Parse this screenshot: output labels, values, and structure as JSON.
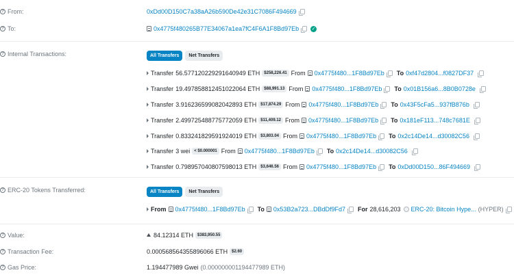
{
  "from": {
    "label": "From:",
    "address": "0xDd00D150C7a38aA26b590De42e31C7086F494669"
  },
  "to": {
    "label": "To:",
    "address": "0x4775f480265B77E34067a1ea7fC4F6A1F8Bd97Eb"
  },
  "internal": {
    "label": "Internal Transactions:",
    "tabs": [
      "All Transfers",
      "Net Transfers"
    ],
    "rows": [
      {
        "prefix": "Transfer",
        "amount": "56.577120229291640949 ETH",
        "usd": "$258,226.41",
        "from_label": "From",
        "from": "0x4775f480...1F8Bd97Eb",
        "to_label": "To",
        "to": "0xf47d2804...f0827DF37"
      },
      {
        "prefix": "Transfer",
        "amount": "19.497858812451022064 ETH",
        "usd": "$88,991.13",
        "from_label": "From",
        "from": "0x4775f480...1F8Bd97Eb",
        "to_label": "To",
        "to": "0x01B156a6...8B0B0728e"
      },
      {
        "prefix": "Transfer",
        "amount": "3.916236599082042893 ETH",
        "usd": "$17,874.29",
        "from_label": "From",
        "from": "0x4775f480...1F8Bd97Eb",
        "to_label": "To",
        "to": "0x43F5cFa5...937fB876b"
      },
      {
        "prefix": "Transfer",
        "amount": "2.499725488775772059 ETH",
        "usd": "$11,409.12",
        "from_label": "From",
        "from": "0x4775f480...1F8Bd97Eb",
        "to_label": "To",
        "to": "0x181eF113...748c7681E"
      },
      {
        "prefix": "Transfer",
        "amount": "0.833241829591924019 ETH",
        "usd": "$3,803.04",
        "from_label": "From",
        "from": "0x4775f480...1F8Bd97Eb",
        "to_label": "To",
        "to": "0x2c14De14...d30082C56"
      },
      {
        "prefix": "Transfer",
        "amount": "3 wei",
        "usd": "< $0.000001",
        "from_label": "From",
        "from": "0x4775f480...1F8Bd97Eb",
        "to_label": "To",
        "to": "0x2c14De14...d30082C56"
      },
      {
        "prefix": "Transfer",
        "amount": "0.798957040807598013 ETH",
        "usd": "$3,646.56",
        "from_label": "From",
        "from": "0x4775f480...1F8Bd97Eb",
        "to_label": "To",
        "to": "0xDd00D150...86F494669"
      }
    ]
  },
  "erc20": {
    "label": "ERC-20 Tokens Transferred:",
    "tabs": [
      "All Transfers",
      "Net Transfers"
    ],
    "row": {
      "from_label": "From",
      "from": "0x4775f480...1F8Bd97Eb",
      "to_label": "To",
      "to": "0x53B2a723...DBdDf9Fd7",
      "for_label": "For",
      "amount": "28,616,203",
      "token": "ERC-20: Bitcoin Hype...",
      "symbol": "(HYPER)"
    }
  },
  "value": {
    "label": "Value:",
    "amount": "84.12314 ETH",
    "usd": "$383,950.55"
  },
  "fee": {
    "label": "Transaction Fee:",
    "amount": "0.000568564355896066 ETH",
    "usd": "$2.60"
  },
  "gas": {
    "label": "Gas Price:",
    "gwei": "1.194477989 Gwei",
    "eth": "(0.000000001194477989 ETH)"
  },
  "icons": [
    "help-circle-icon",
    "copy-icon",
    "contract-icon",
    "verified-check-icon",
    "caret-right-icon",
    "token-icon",
    "eth-icon"
  ],
  "colors": {
    "link": "#0784c3",
    "accent": "#0784c3",
    "verified": "#00a186",
    "muted": "#6c757d"
  }
}
